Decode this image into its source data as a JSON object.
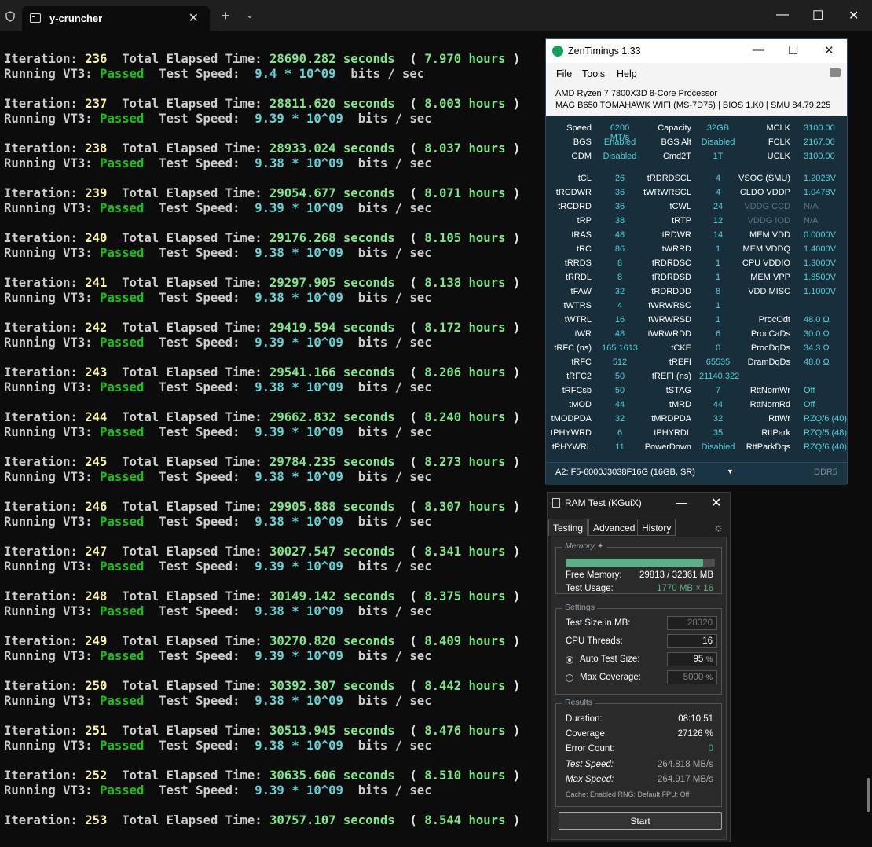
{
  "terminal": {
    "tab_title": "y-cruncher",
    "iterations": [
      {
        "n": "236",
        "seconds": "28690.282",
        "hours": "7.970",
        "speed": "9.4 * 10^09"
      },
      {
        "n": "237",
        "seconds": "28811.620",
        "hours": "8.003",
        "speed": "9.39 * 10^09"
      },
      {
        "n": "238",
        "seconds": "28933.024",
        "hours": "8.037",
        "speed": "9.38 * 10^09"
      },
      {
        "n": "239",
        "seconds": "29054.677",
        "hours": "8.071",
        "speed": "9.39 * 10^09"
      },
      {
        "n": "240",
        "seconds": "29176.268",
        "hours": "8.105",
        "speed": "9.38 * 10^09"
      },
      {
        "n": "241",
        "seconds": "29297.905",
        "hours": "8.138",
        "speed": "9.38 * 10^09"
      },
      {
        "n": "242",
        "seconds": "29419.594",
        "hours": "8.172",
        "speed": "9.39 * 10^09"
      },
      {
        "n": "243",
        "seconds": "29541.166",
        "hours": "8.206",
        "speed": "9.38 * 10^09"
      },
      {
        "n": "244",
        "seconds": "29662.832",
        "hours": "8.240",
        "speed": "9.39 * 10^09"
      },
      {
        "n": "245",
        "seconds": "29784.235",
        "hours": "8.273",
        "speed": "9.38 * 10^09"
      },
      {
        "n": "246",
        "seconds": "29905.888",
        "hours": "8.307",
        "speed": "9.38 * 10^09"
      },
      {
        "n": "247",
        "seconds": "30027.547",
        "hours": "8.341",
        "speed": "9.39 * 10^09"
      },
      {
        "n": "248",
        "seconds": "30149.142",
        "hours": "8.375",
        "speed": "9.38 * 10^09"
      },
      {
        "n": "249",
        "seconds": "30270.820",
        "hours": "8.409",
        "speed": "9.39 * 10^09"
      },
      {
        "n": "250",
        "seconds": "30392.307",
        "hours": "8.442",
        "speed": "9.38 * 10^09"
      },
      {
        "n": "251",
        "seconds": "30513.945",
        "hours": "8.476",
        "speed": "9.38 * 10^09"
      },
      {
        "n": "252",
        "seconds": "30635.606",
        "hours": "8.510",
        "speed": "9.39 * 10^09"
      }
    ],
    "last_iteration": {
      "n": "253",
      "seconds": "30757.107",
      "hours": "8.544"
    },
    "labels": {
      "iteration": "Iteration:",
      "elapsed": "Total Elapsed Time:",
      "seconds": "seconds",
      "hours": "hours",
      "open_paren": "(",
      "close_paren": ")",
      "running": "Running VT3:",
      "passed": "Passed",
      "speed": "Test Speed:",
      "unit": "bits / sec"
    }
  },
  "zentimings": {
    "title": "ZenTimings 1.33",
    "menu": [
      "File",
      "Tools",
      "Help"
    ],
    "cpu": "AMD Ryzen 7 7800X3D 8-Core Processor",
    "board": "MAG B650 TOMAHAWK WIFI (MS-7D75) | BIOS 1.K0 | SMU 84.79.225",
    "top_rows": [
      [
        [
          "Speed",
          "6200 MT/s"
        ],
        [
          "Capacity",
          "32GB"
        ],
        [
          "MCLK",
          "3100.00"
        ]
      ],
      [
        [
          "BGS",
          "Enabled"
        ],
        [
          "BGS Alt",
          "Disabled"
        ],
        [
          "FCLK",
          "2167.00"
        ]
      ],
      [
        [
          "GDM",
          "Disabled"
        ],
        [
          "Cmd2T",
          "1T"
        ],
        [
          "UCLK",
          "3100.00"
        ]
      ]
    ],
    "rows": [
      [
        [
          "tCL",
          "26"
        ],
        [
          "tRDRDSCL",
          "4"
        ],
        [
          "VSOC (SMU)",
          "1.2023V"
        ]
      ],
      [
        [
          "tRCDWR",
          "36"
        ],
        [
          "tWRWRSCL",
          "4"
        ],
        [
          "CLDO VDDP",
          "1.0478V"
        ]
      ],
      [
        [
          "tRCDRD",
          "36"
        ],
        [
          "tCWL",
          "24"
        ],
        [
          "VDDG CCD",
          "N/A"
        ]
      ],
      [
        [
          "tRP",
          "38"
        ],
        [
          "tRTP",
          "12"
        ],
        [
          "VDDG IOD",
          "N/A"
        ]
      ],
      [
        [
          "tRAS",
          "48"
        ],
        [
          "tRDWR",
          "14"
        ],
        [
          "MEM VDD",
          "0.0000V"
        ]
      ],
      [
        [
          "tRC",
          "86"
        ],
        [
          "tWRRD",
          "1"
        ],
        [
          "MEM VDDQ",
          "1.4000V"
        ]
      ],
      [
        [
          "tRRDS",
          "8"
        ],
        [
          "tRDRDSC",
          "1"
        ],
        [
          "CPU VDDIO",
          "1.3000V"
        ]
      ],
      [
        [
          "tRRDL",
          "8"
        ],
        [
          "tRDRDSD",
          "1"
        ],
        [
          "MEM VPP",
          "1.8500V"
        ]
      ],
      [
        [
          "tFAW",
          "32"
        ],
        [
          "tRDRDDD",
          "8"
        ],
        [
          "VDD MISC",
          "1.1000V"
        ]
      ],
      [
        [
          "tWTRS",
          "4"
        ],
        [
          "tWRWRSC",
          "1"
        ],
        [
          "",
          ""
        ]
      ],
      [
        [
          "tWTRL",
          "16"
        ],
        [
          "tWRWRSD",
          "1"
        ],
        [
          "ProcOdt",
          "48.0 Ω"
        ]
      ],
      [
        [
          "tWR",
          "48"
        ],
        [
          "tWRWRDD",
          "6"
        ],
        [
          "ProcCaDs",
          "30.0 Ω"
        ]
      ],
      [
        [
          "tRFC (ns)",
          "165.1613"
        ],
        [
          "tCKE",
          "0"
        ],
        [
          "ProcDqDs",
          "34.3 Ω"
        ]
      ],
      [
        [
          "tRFC",
          "512"
        ],
        [
          "tREFI",
          "65535"
        ],
        [
          "DramDqDs",
          "48.0 Ω"
        ]
      ],
      [
        [
          "tRFC2",
          "50"
        ],
        [
          "tREFI (ns)",
          "21140.322"
        ],
        [
          "",
          ""
        ]
      ],
      [
        [
          "tRFCsb",
          "50"
        ],
        [
          "tSTAG",
          "7"
        ],
        [
          "RttNomWr",
          "Off"
        ]
      ],
      [
        [
          "tMOD",
          "44"
        ],
        [
          "tMRD",
          "44"
        ],
        [
          "RttNomRd",
          "Off"
        ]
      ],
      [
        [
          "tMODPDA",
          "32"
        ],
        [
          "tMRDPDA",
          "32"
        ],
        [
          "RttWr",
          "RZQ/6 (40)"
        ]
      ],
      [
        [
          "tPHYWRD",
          "6"
        ],
        [
          "tPHYRDL",
          "35"
        ],
        [
          "RttPark",
          "RZQ/5 (48)"
        ]
      ],
      [
        [
          "tPHYWRL",
          "11"
        ],
        [
          "PowerDown",
          "Disabled"
        ],
        [
          "RttParkDqs",
          "RZQ/6 (40)"
        ]
      ]
    ],
    "module": "A2: F5-6000J3038F16G (16GB, SR)",
    "ddr": "DDR5",
    "colors": {
      "bg": "#182e3b",
      "value": "#4fd1d9",
      "dim": "#5e7380"
    }
  },
  "ramtest": {
    "title": "RAM Test (KGuiX)",
    "tabs": [
      "Testing",
      "Advanced",
      "History"
    ],
    "memory": {
      "group": "Memory",
      "usage_fraction": 0.92,
      "free_label": "Free Memory:",
      "free_value": "29813 / 32361 MB",
      "usage_label": "Test Usage:",
      "usage_value": "1770 MB × 16"
    },
    "settings": {
      "group": "Settings",
      "size_label": "Test Size in MB:",
      "size_value": "28320",
      "threads_label": "CPU Threads:",
      "threads_value": "16",
      "auto_label": "Auto Test Size:",
      "auto_value": "95",
      "cov_label": "Max Coverage:",
      "cov_value": "5000",
      "pct": "%"
    },
    "results": {
      "group": "Results",
      "duration_label": "Duration:",
      "duration": "08:10:51",
      "coverage_label": "Coverage:",
      "coverage": "27126 %",
      "errors_label": "Error Count:",
      "errors": "0",
      "speed_label": "Test Speed:",
      "speed": "264.818 MB/s",
      "max_label": "Max Speed:",
      "max": "264.917 MB/s",
      "footer": "Cache: Enabled  RNG: Default  FPU: Off"
    },
    "start": "Start"
  }
}
